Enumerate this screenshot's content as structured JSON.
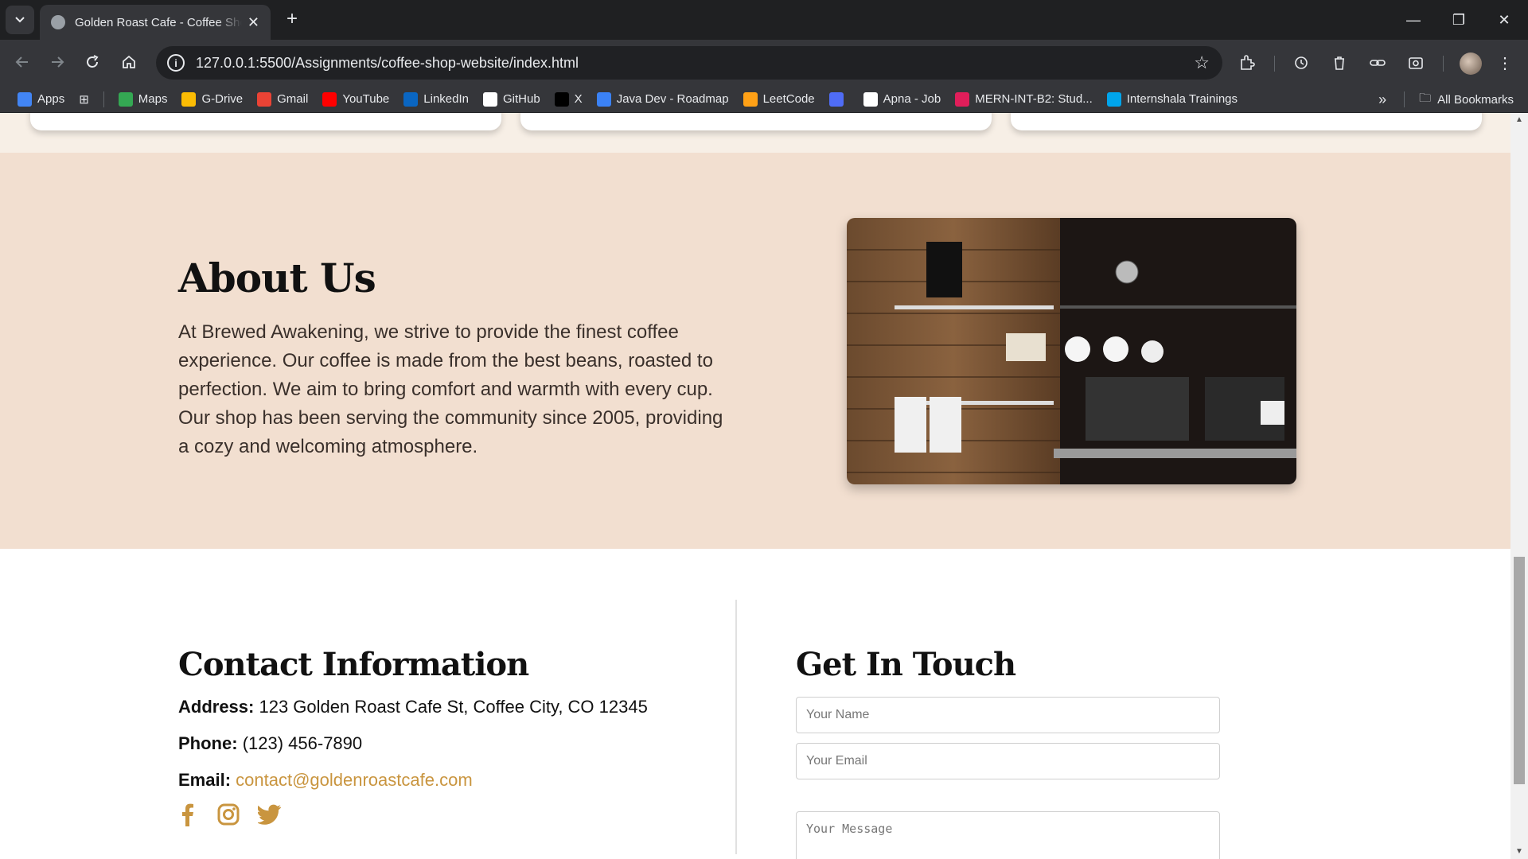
{
  "browser": {
    "tab_title": "Golden Roast Cafe - Coffee Shop",
    "url": "127.0.0.1:5500/Assignments/coffee-shop-website/index.html",
    "bookmarks": [
      {
        "label": "Apps",
        "icon": "apps-grid-icon",
        "color": "#4285f4"
      },
      {
        "label": "Maps",
        "icon": "maps-icon",
        "color": "#34a853"
      },
      {
        "label": "G-Drive",
        "icon": "drive-icon",
        "color": "#fbbc04"
      },
      {
        "label": "Gmail",
        "icon": "gmail-icon",
        "color": "#ea4335"
      },
      {
        "label": "YouTube",
        "icon": "youtube-icon",
        "color": "#ff0000"
      },
      {
        "label": "LinkedIn",
        "icon": "linkedin-icon",
        "color": "#0a66c2"
      },
      {
        "label": "GitHub",
        "icon": "github-icon",
        "color": "#ffffff"
      },
      {
        "label": "X",
        "icon": "x-icon",
        "color": "#000000"
      },
      {
        "label": "Java Dev - Roadmap",
        "icon": "chat-icon",
        "color": "#3b82f6"
      },
      {
        "label": "LeetCode",
        "icon": "leetcode-icon",
        "color": "#ffa116"
      },
      {
        "label": "",
        "icon": "s-icon",
        "color": "#4f6cf5"
      },
      {
        "label": "Apna - Job",
        "icon": "apna-icon",
        "color": "#ffffff"
      },
      {
        "label": "MERN-INT-B2: Stud...",
        "icon": "slack-icon",
        "color": "#e01e5a"
      },
      {
        "label": "Internshala Trainings",
        "icon": "ist-icon",
        "color": "#00a5ec"
      }
    ],
    "all_bookmarks": "All Bookmarks"
  },
  "about": {
    "title": "About Us",
    "text": "At Brewed Awakening, we strive to provide the finest coffee experience. Our coffee is made from the best beans, roasted to perfection. We aim to bring comfort and warmth with every cup. Our shop has been serving the community since 2005, providing a cozy and welcoming atmosphere."
  },
  "contact": {
    "title": "Contact Information",
    "address_label": "Address:",
    "address": "123 Golden Roast Cafe St, Coffee City, CO 12345",
    "phone_label": "Phone:",
    "phone": "(123) 456-7890",
    "email_label": "Email:",
    "email": "contact@goldenroastcafe.com",
    "socials": [
      "facebook-icon",
      "instagram-icon",
      "twitter-icon"
    ]
  },
  "form": {
    "title": "Get In Touch",
    "name_placeholder": "Your Name",
    "email_placeholder": "Your Email",
    "message_placeholder": "Your Message"
  },
  "colors": {
    "accent": "#c9953f",
    "about_bg": "#f2dfd0",
    "strip_bg": "#f7efe6"
  }
}
